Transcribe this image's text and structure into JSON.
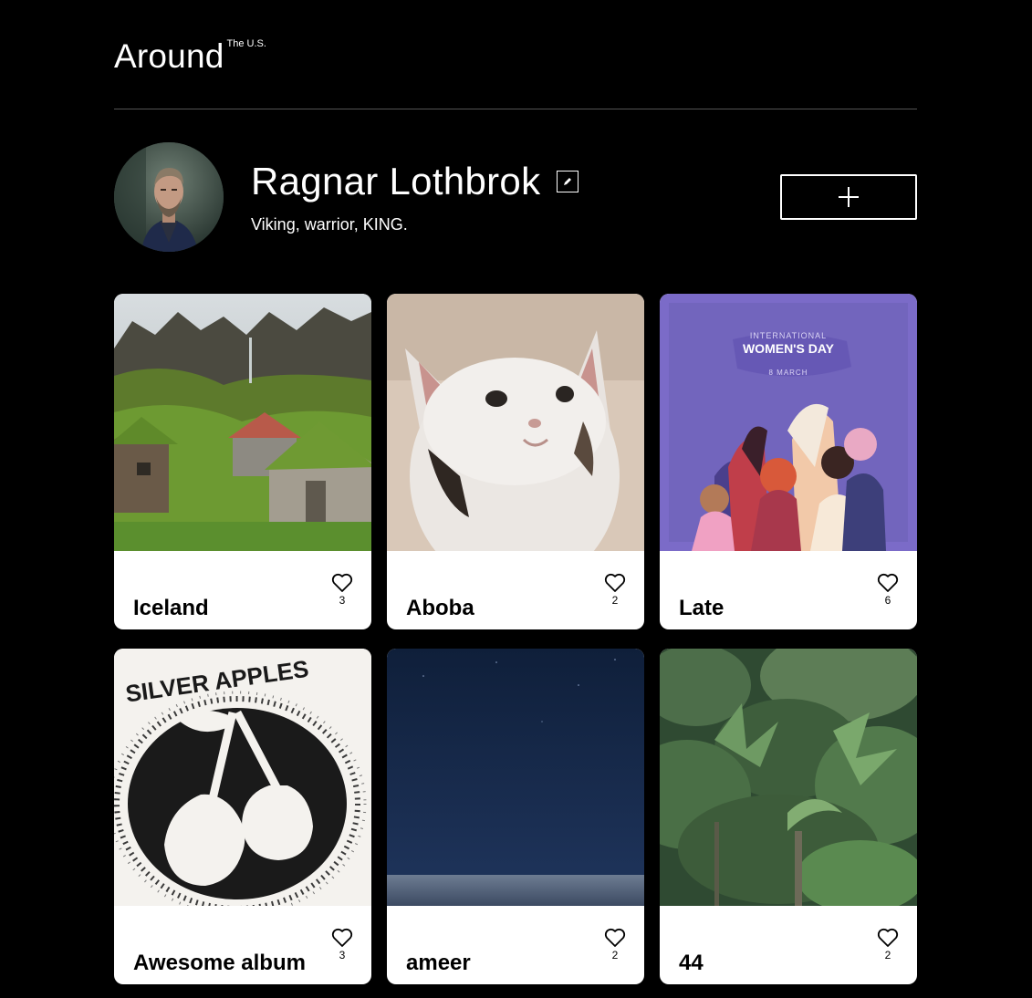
{
  "header": {
    "logo_main": "Around",
    "logo_sup": "The U.S."
  },
  "profile": {
    "name": "Ragnar Lothbrok",
    "about": "Viking, warrior, KING."
  },
  "icons": {
    "edit": "pencil-icon",
    "add": "plus-icon",
    "like": "heart-icon"
  },
  "colors": {
    "background": "#000000",
    "card": "#ffffff",
    "divider": "#545454"
  },
  "cards": [
    {
      "title": "Iceland",
      "likes": "3"
    },
    {
      "title": "Aboba",
      "likes": "2"
    },
    {
      "title": "Late",
      "likes": "6"
    },
    {
      "title": "Awesome album",
      "likes": "3"
    },
    {
      "title": "ameer",
      "likes": "2"
    },
    {
      "title": "44",
      "likes": "2"
    }
  ],
  "card_images": {
    "late_poster": {
      "line1": "INTERNATIONAL",
      "line2": "WOMEN'S DAY",
      "line3": "8 MARCH"
    },
    "album_cover": {
      "band": "SILVER APPLES"
    }
  }
}
